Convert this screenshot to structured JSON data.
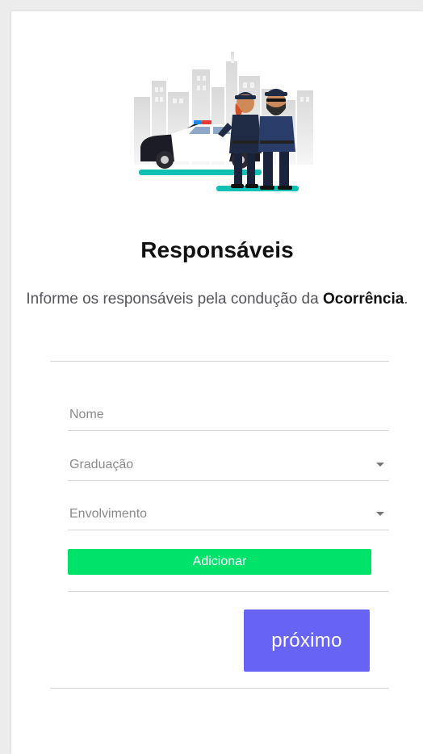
{
  "page": {
    "title": "Responsáveis",
    "subtitle_prefix": "Informe os responsáveis pela condução da ",
    "subtitle_bold": "Ocorrência",
    "subtitle_suffix": "."
  },
  "form": {
    "nome": {
      "label": "Nome"
    },
    "graduacao": {
      "label": "Graduação"
    },
    "envolvimento": {
      "label": "Envolvimento"
    },
    "add_button_label": "Adicionar"
  },
  "actions": {
    "next_label": "próximo"
  },
  "illustration": {
    "icon": "police-officers-illustration"
  },
  "colors": {
    "add_button": "#00e36b",
    "next_button": "#6763f5",
    "accent_teal": "#11c0b5"
  }
}
